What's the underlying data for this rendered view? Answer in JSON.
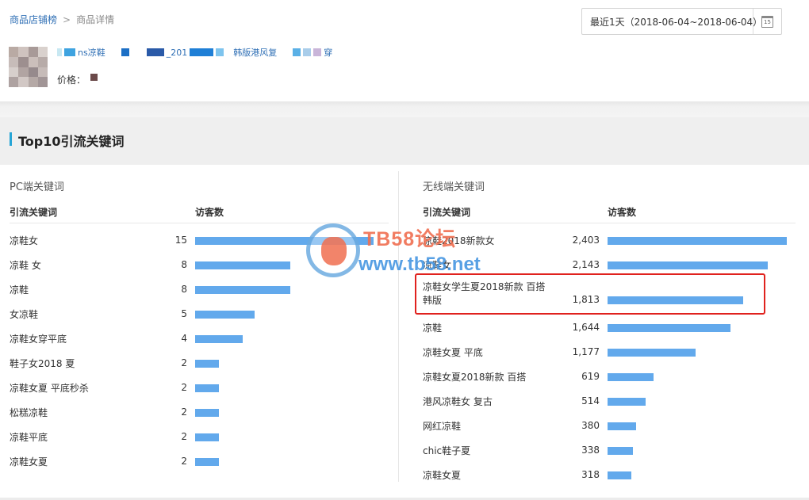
{
  "breadcrumb": {
    "parent": "商品店铺榜",
    "separator": ">",
    "current": "商品详情"
  },
  "date_range": {
    "label": "最近1天（2018-06-04~2018-06-04）",
    "calendar_day": "15"
  },
  "product": {
    "title_fragments": [
      "ns凉鞋",
      "_201",
      "韩版港风复",
      "穿"
    ],
    "price_label": "价格："
  },
  "section": {
    "title": "Top10引流关键词"
  },
  "pc": {
    "title": "PC端关键词",
    "col_keyword": "引流关键词",
    "col_visitors": "访客数",
    "max": 15,
    "rows": [
      {
        "keyword": "凉鞋女",
        "visitors": 15,
        "display": "15"
      },
      {
        "keyword": "凉鞋 女",
        "visitors": 8,
        "display": "8"
      },
      {
        "keyword": "凉鞋",
        "visitors": 8,
        "display": "8"
      },
      {
        "keyword": "女凉鞋",
        "visitors": 5,
        "display": "5"
      },
      {
        "keyword": "凉鞋女穿平底",
        "visitors": 4,
        "display": "4"
      },
      {
        "keyword": "鞋子女2018 夏",
        "visitors": 2,
        "display": "2"
      },
      {
        "keyword": "凉鞋女夏 平底秒杀",
        "visitors": 2,
        "display": "2"
      },
      {
        "keyword": "松糕凉鞋",
        "visitors": 2,
        "display": "2"
      },
      {
        "keyword": "凉鞋平底",
        "visitors": 2,
        "display": "2"
      },
      {
        "keyword": "凉鞋女夏",
        "visitors": 2,
        "display": "2"
      }
    ]
  },
  "mobile": {
    "title": "无线端关键词",
    "col_keyword": "引流关键词",
    "col_visitors": "访客数",
    "max": 2403,
    "rows": [
      {
        "keyword": "凉鞋2018新款女",
        "visitors": 2403,
        "display": "2,403"
      },
      {
        "keyword": "凉鞋女",
        "visitors": 2143,
        "display": "2,143"
      },
      {
        "keyword": "凉鞋女学生夏2018新款 百搭\n韩版",
        "visitors": 1813,
        "display": "1,813"
      },
      {
        "keyword": "凉鞋",
        "visitors": 1644,
        "display": "1,644"
      },
      {
        "keyword": "凉鞋女夏 平底",
        "visitors": 1177,
        "display": "1,177"
      },
      {
        "keyword": "凉鞋女夏2018新款 百搭",
        "visitors": 619,
        "display": "619"
      },
      {
        "keyword": "港风凉鞋女 复古",
        "visitors": 514,
        "display": "514"
      },
      {
        "keyword": "网红凉鞋",
        "visitors": 380,
        "display": "380"
      },
      {
        "keyword": "chic鞋子夏",
        "visitors": 338,
        "display": "338"
      },
      {
        "keyword": "凉鞋女夏",
        "visitors": 318,
        "display": "318"
      }
    ]
  },
  "watermark": {
    "line1": "TB58论坛",
    "line2": "www.tb58.net"
  },
  "colors": {
    "bar": "#62a9ec",
    "accent": "#27a5d6",
    "highlight": "#e0221e",
    "link": "#2f6fb5"
  }
}
